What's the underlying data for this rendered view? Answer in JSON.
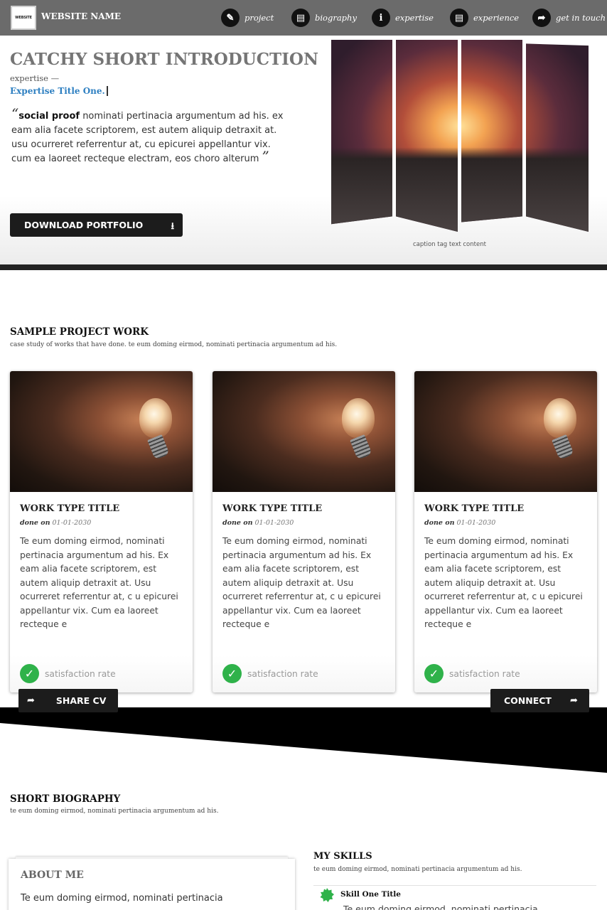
{
  "nav": {
    "logo_text": "WEBSITE",
    "site_name": "WEBSITE NAME",
    "items": [
      {
        "label": "project",
        "icon": "pencil-icon"
      },
      {
        "label": "biography",
        "icon": "book-icon"
      },
      {
        "label": "expertise",
        "icon": "info-icon"
      },
      {
        "label": "experience",
        "icon": "book-icon"
      },
      {
        "label": "get in touch",
        "icon": "share-arrow-icon"
      }
    ]
  },
  "hero": {
    "title": "CATCHY SHORT INTRODUCTION",
    "expertise_label": "expertise —",
    "expertise_title": "Expertise Title One.",
    "quote_bold": "social proof",
    "quote_text": " nominati pertinacia argumentum ad his. ex eam alia facete scriptorem, est autem aliquip detraxit at. usu ocurreret referrentur at, cu epicurei appellantur vix. cum ea laoreet recteque electram, eos choro alterum",
    "download_label": "DOWNLOAD PORTFOLIO",
    "caption": "caption tag text content"
  },
  "projects": {
    "title": "SAMPLE PROJECT WORK",
    "subtitle": "case study of works that have done. te eum doming eirmod, nominati pertinacia argumentum ad his.",
    "cards": [
      {
        "title": "WORK TYPE TITLE",
        "date_label": "done on",
        "date": "01-01-2030",
        "body": "Te eum doming eirmod, nominati pertinacia argumentum ad his. Ex eam alia facete scriptorem, est autem aliquip detraxit at. Usu ocurreret referrentur at, c u epicurei appellantur vix. Cum ea laoreet recteque e",
        "footer": "satisfaction rate"
      },
      {
        "title": "WORK TYPE TITLE",
        "date_label": "done on",
        "date": "01-01-2030",
        "body": "Te eum doming eirmod, nominati pertinacia argumentum ad his. Ex eam alia facete scriptorem, est autem aliquip detraxit at. Usu ocurreret referrentur at, c u epicurei appellantur vix. Cum ea laoreet recteque e",
        "footer": "satisfaction rate"
      },
      {
        "title": "WORK TYPE TITLE",
        "date_label": "done on",
        "date": "01-01-2030",
        "body": "Te eum doming eirmod, nominati pertinacia argumentum ad his. Ex eam alia facete scriptorem, est autem aliquip detraxit at. Usu ocurreret referrentur at, c u epicurei appellantur vix. Cum ea laoreet recteque e",
        "footer": "satisfaction rate"
      }
    ],
    "share_label": "SHARE CV",
    "connect_label": "CONNECT"
  },
  "bio": {
    "title": "SHORT BIOGRAPHY",
    "subtitle": "te eum doming eirmod, nominati pertinacia argumentum ad his.",
    "about_title": "ABOUT ME",
    "about_text": "Te eum doming eirmod, nominati pertinacia"
  },
  "skills": {
    "title": "MY SKILLS",
    "subtitle": "te eum doming eirmod, nominati pertinacia argumentum ad his.",
    "items": [
      {
        "title": "Skill One Title",
        "text": "Te eum doming eirmod, nominati pertinacia"
      }
    ]
  },
  "colors": {
    "nav_bg": "#6b6b6b",
    "accent_blue": "#2d7fc1",
    "success_green": "#2fb24a",
    "dark": "#1c1c1c"
  }
}
